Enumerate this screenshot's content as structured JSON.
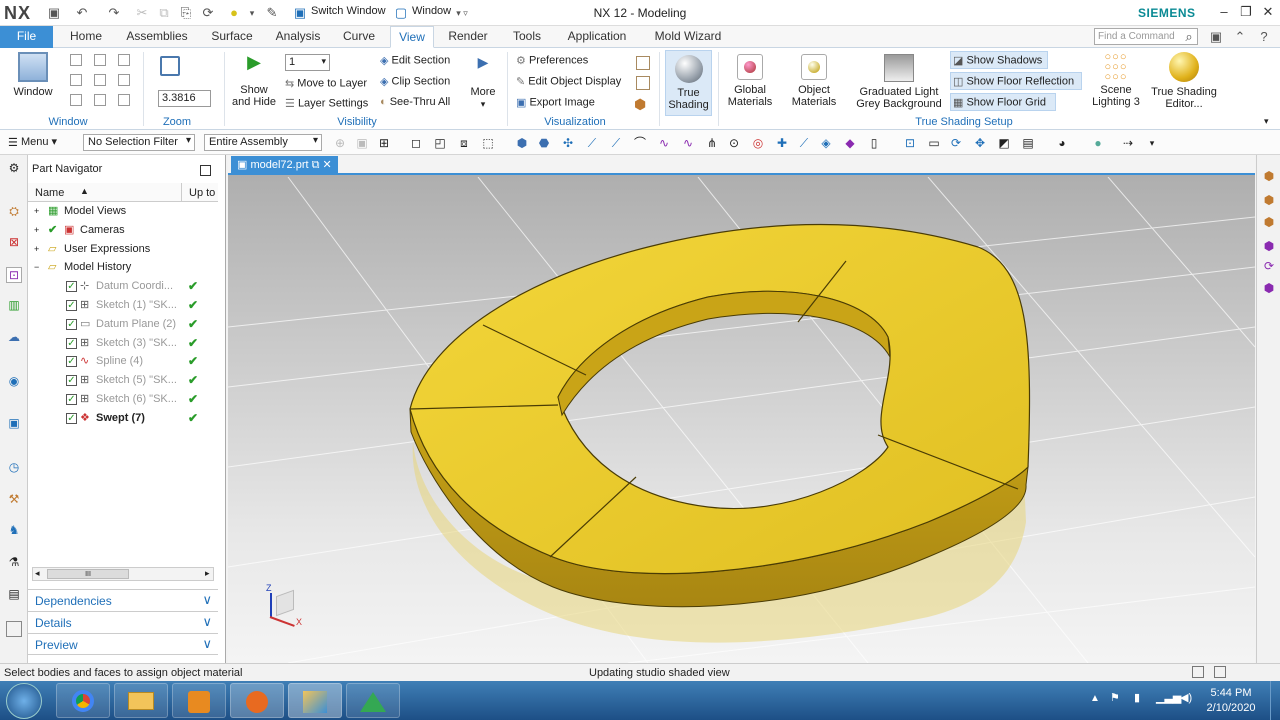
{
  "titlebar": {
    "logo": "NX",
    "switch_window": "Switch Window",
    "window_menu": "Window",
    "app_title": "NX 12 - Modeling",
    "brand": "SIEMENS",
    "brand_color": "#0a8a94"
  },
  "tabs": [
    "File",
    "Home",
    "Assemblies",
    "Surface",
    "Analysis",
    "Curve",
    "View",
    "Render",
    "Tools",
    "Application",
    "Mold Wizard"
  ],
  "active_tab": "View",
  "find_command_placeholder": "Find a Command",
  "ribbon": {
    "window_btn": "Window",
    "window_group": "Window",
    "zoom_value": "3.3816",
    "zoom_group": "Zoom",
    "layer_value": "1",
    "show_hide": [
      "Show",
      "and Hide"
    ],
    "move_to_layer": "Move to Layer",
    "layer_settings": "Layer Settings",
    "edit_section": "Edit Section",
    "clip_section": "Clip Section",
    "see_thru_all": "See-Thru All",
    "more": "More",
    "visibility_group": "Visibility",
    "preferences": "Preferences",
    "edit_object_display": "Edit Object Display",
    "export_image": "Export Image",
    "visualization_group": "Visualization",
    "true_shading": [
      "True",
      "Shading"
    ],
    "global_materials": [
      "Global",
      "Materials"
    ],
    "object_materials": [
      "Object",
      "Materials"
    ],
    "graduated_bg": [
      "Graduated Light",
      "Grey Background"
    ],
    "show_shadows": "Show Shadows",
    "show_floor_reflection": "Show Floor Reflection",
    "show_floor_grid": "Show Floor Grid",
    "scene_lighting": [
      "Scene",
      "Lighting 3"
    ],
    "true_shading_editor": [
      "True Shading",
      "Editor..."
    ],
    "true_shading_setup_group": "True Shading Setup"
  },
  "cmdbar": {
    "menu": "Menu",
    "selection_filter": "No Selection Filter",
    "scope": "Entire Assembly"
  },
  "navigator": {
    "title": "Part Navigator",
    "col_name": "Name",
    "col_uptodate": "Up to",
    "rows": [
      {
        "label": "Model Views",
        "check": ""
      },
      {
        "label": "Cameras",
        "check": ""
      },
      {
        "label": "User Expressions",
        "check": ""
      },
      {
        "label": "Model History",
        "check": ""
      },
      {
        "label": "Datum Coordi...",
        "check": "✔"
      },
      {
        "label": "Sketch (1) \"SK...",
        "check": "✔"
      },
      {
        "label": "Datum Plane (2)",
        "check": "✔"
      },
      {
        "label": "Sketch (3) \"SK...",
        "check": "✔"
      },
      {
        "label": "Spline (4)",
        "check": "✔"
      },
      {
        "label": "Sketch (5) \"SK...",
        "check": "✔"
      },
      {
        "label": "Sketch (6) \"SK...",
        "check": "✔"
      },
      {
        "label": "Swept (7)",
        "check": "✔"
      }
    ],
    "scroll_thumb": "III",
    "panels": [
      "Dependencies",
      "Details",
      "Preview"
    ]
  },
  "viewport": {
    "tab_label": "model72.prt",
    "model_color": "#e8c92a",
    "triad_z": "Z",
    "triad_x": "X"
  },
  "status": {
    "left": "Select bodies and faces to assign object material",
    "center": "Updating studio shaded view"
  },
  "taskbar": {
    "time": "5:44 PM",
    "date": "2/10/2020"
  }
}
